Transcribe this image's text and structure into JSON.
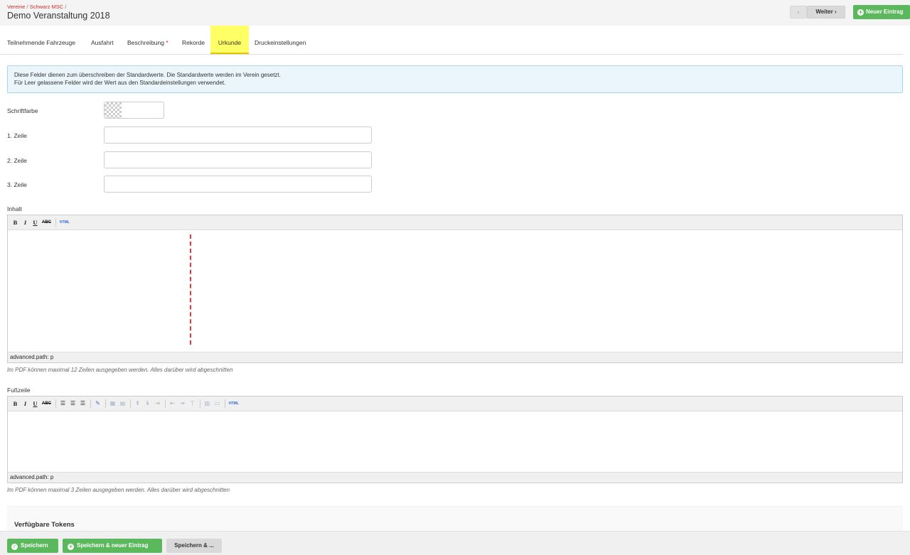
{
  "header": {
    "breadcrumb": [
      "Vereine",
      "Schwarz MSC"
    ],
    "breadcrumb_sep": "/",
    "title": "Demo Veranstaltung 2018",
    "prev_label": "‹",
    "next_label": "Weiter ›",
    "new_label": "Neuer Eintrag"
  },
  "tabs": [
    {
      "label": "Teilnehmende Fahrzeuge",
      "active": false
    },
    {
      "label": "Ausfahrt",
      "active": false
    },
    {
      "label": "Beschreibung",
      "required": "*",
      "active": false
    },
    {
      "label": "Rekorde",
      "active": false
    },
    {
      "label": "Urkunde",
      "active": true
    },
    {
      "label": "Druckeinstellungen",
      "active": false
    }
  ],
  "info": {
    "line1": "Diese Felder dienen zum überschreiben der Standardwerte. Die Standardwerte werden im Verein gesetzt.",
    "line2": "Für Leer gelassene Felder wird der Wert aus den Standardeinstellungen verwendet."
  },
  "form": {
    "schriftfarbe_label": "Schriftfarbe",
    "schriftfarbe_value": "",
    "zeile1_label": "1. Zeile",
    "zeile1_value": "",
    "zeile2_label": "2. Zeile",
    "zeile2_value": "",
    "zeile3_label": "3. Zeile",
    "zeile3_value": ""
  },
  "inhalt": {
    "label": "Inhalt",
    "toolbar": {
      "bold": "B",
      "italic": "I",
      "underline": "U",
      "strike": "ABC",
      "html": "HTML"
    },
    "status": "advanced.path: p",
    "hint": "Im PDF können maximal 12 Zeilen ausgegeben werden. Alles darüber wird abgeschnitten",
    "guide_color": "#e53935"
  },
  "fusszeile": {
    "label": "Fußzeile",
    "toolbar": {
      "bold": "B",
      "italic": "I",
      "underline": "U",
      "strike": "ABC",
      "html": "HTML"
    },
    "toolbar_icons": [
      "align-left-icon",
      "align-center-icon",
      "align-right-icon",
      "edit-icon",
      "table-icon",
      "table-props-icon",
      "insert-row-before-icon",
      "insert-row-after-icon",
      "delete-row-icon",
      "insert-col-before-icon",
      "insert-col-after-icon",
      "delete-col-icon",
      "split-cells-icon",
      "merge-cells-icon"
    ],
    "status": "advanced.path: p",
    "hint": "Im PDF können maximal 3 Zeilen ausgegeben werden. Alles darüber wird abgeschnitten"
  },
  "tokens": {
    "title": "Verfügbare Tokens"
  },
  "footer": {
    "save_label": "Speichern",
    "save_new_label": "Speichern & neuer Eintrag",
    "save_more_label": "Speichern & ..."
  },
  "colors": {
    "accent_green": "#5cb85c",
    "breadcrumb_red": "#c9302c",
    "active_tab_highlight": "#ffff66",
    "info_bg": "#eaf6fb"
  }
}
